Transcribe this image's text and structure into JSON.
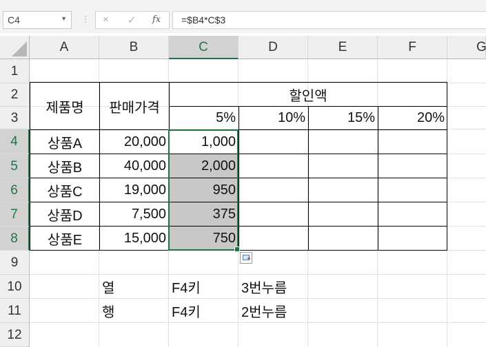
{
  "name_box": {
    "value": "C4"
  },
  "formula_bar": {
    "value": "=$B4*C$3",
    "cancel_icon": "×",
    "enter_icon": "✓",
    "fx_icon": "fx"
  },
  "columns": [
    "A",
    "B",
    "C",
    "D",
    "E",
    "F",
    "G"
  ],
  "rows": [
    "1",
    "2",
    "3",
    "4",
    "5",
    "6",
    "7",
    "8",
    "9",
    "10",
    "11",
    "12"
  ],
  "selected_cell": "C4",
  "colors": {
    "selection": "#217346",
    "gray_fill": "#c8c8c8"
  },
  "sheet": {
    "product_header": "제품명",
    "price_header": "판매가격",
    "discount_header": "할인액",
    "rates": [
      "5%",
      "10%",
      "15%",
      "20%"
    ],
    "products": [
      {
        "name": "상품A",
        "price": "20,000",
        "discount5": "1,000"
      },
      {
        "name": "상품B",
        "price": "40,000",
        "discount5": "2,000"
      },
      {
        "name": "상품C",
        "price": "19,000",
        "discount5": "950"
      },
      {
        "name": "상품D",
        "price": "7,500",
        "discount5": "375"
      },
      {
        "name": "상품E",
        "price": "15,000",
        "discount5": "750"
      }
    ],
    "notes": [
      {
        "label": "열",
        "key": "F4키",
        "action": "3번누름"
      },
      {
        "label": "행",
        "key": "F4키",
        "action": "2번누름"
      }
    ]
  }
}
